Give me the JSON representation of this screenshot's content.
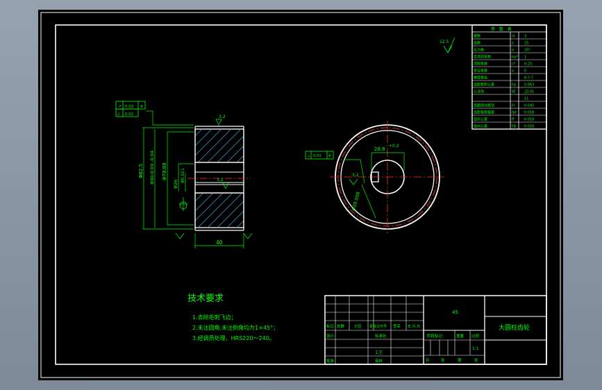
{
  "drawing": {
    "title": "大圆柱齿轮",
    "tech_req_title": "技术要求",
    "tech_req": [
      "1.去除毛刺飞边；",
      "2.未注圆角,未注倒角均为1×45°；",
      "3.经调质处理，HRS220～240。"
    ],
    "dims": {
      "d1": "Φ82.5",
      "d2": "Φ80-0.09\n-0.04",
      "d3": "Φ78.88",
      "d4": "Φ26",
      "d5": "Φ0.021",
      "width": "40",
      "keyway": "28.8",
      "key_tol": "+0.2",
      "rough1": "3.2",
      "rough2": "3.2",
      "rough3": "3.2",
      "rough_top": "12.5",
      "circ_dim": "Φ28.008"
    },
    "gd_t": {
      "r1a": "↗",
      "r1b": "0.03",
      "r1c": "A",
      "r2a": "//",
      "r2b": "0.02",
      "circ_a": "⊥",
      "circ_b": "0.03",
      "circ_c": "A"
    },
    "param_table": {
      "header": "参 数 表",
      "rows": [
        [
          "模数",
          "m",
          "3"
        ],
        [
          "齿数",
          "z",
          "25"
        ],
        [
          "压力角",
          "α",
          "20°"
        ],
        [
          "齿顶高系数",
          "ha*",
          "1"
        ],
        [
          "顶隙系数",
          "c*",
          "0.25"
        ],
        [
          "变位系数",
          "x",
          "0"
        ],
        [
          "精度等级",
          "",
          "8-7-7"
        ],
        [
          "齿距累积公差",
          "Fp",
          "0.063"
        ],
        [
          "公法线",
          "W",
          "23.01"
        ],
        [
          "",
          "",
          "11"
        ],
        [
          "齿圈径向跳动",
          "Fr",
          "0.045"
        ],
        [
          "齿距极限偏差",
          "fpt",
          "0.018"
        ],
        [
          "齿形公差",
          "ff",
          "0.018"
        ],
        [
          "齿向公差",
          "Fβ",
          "0.018"
        ]
      ]
    },
    "title_block": {
      "material": "45",
      "scale": "1:1",
      "stage": "阶段标记",
      "weight": "重量",
      "ratio": "比例",
      "c1": "标记",
      "c2": "处数",
      "c3": "分区",
      "c4": "更改文件号",
      "c5": "签名",
      "c6": "年.月.日",
      "design": "设计",
      "standard": "标准化",
      "review": "审核",
      "craft": "工艺",
      "approve": "批准",
      "sheet": "共",
      "sheet2": "张",
      "sheet3": "第",
      "sheet4": "张"
    }
  }
}
